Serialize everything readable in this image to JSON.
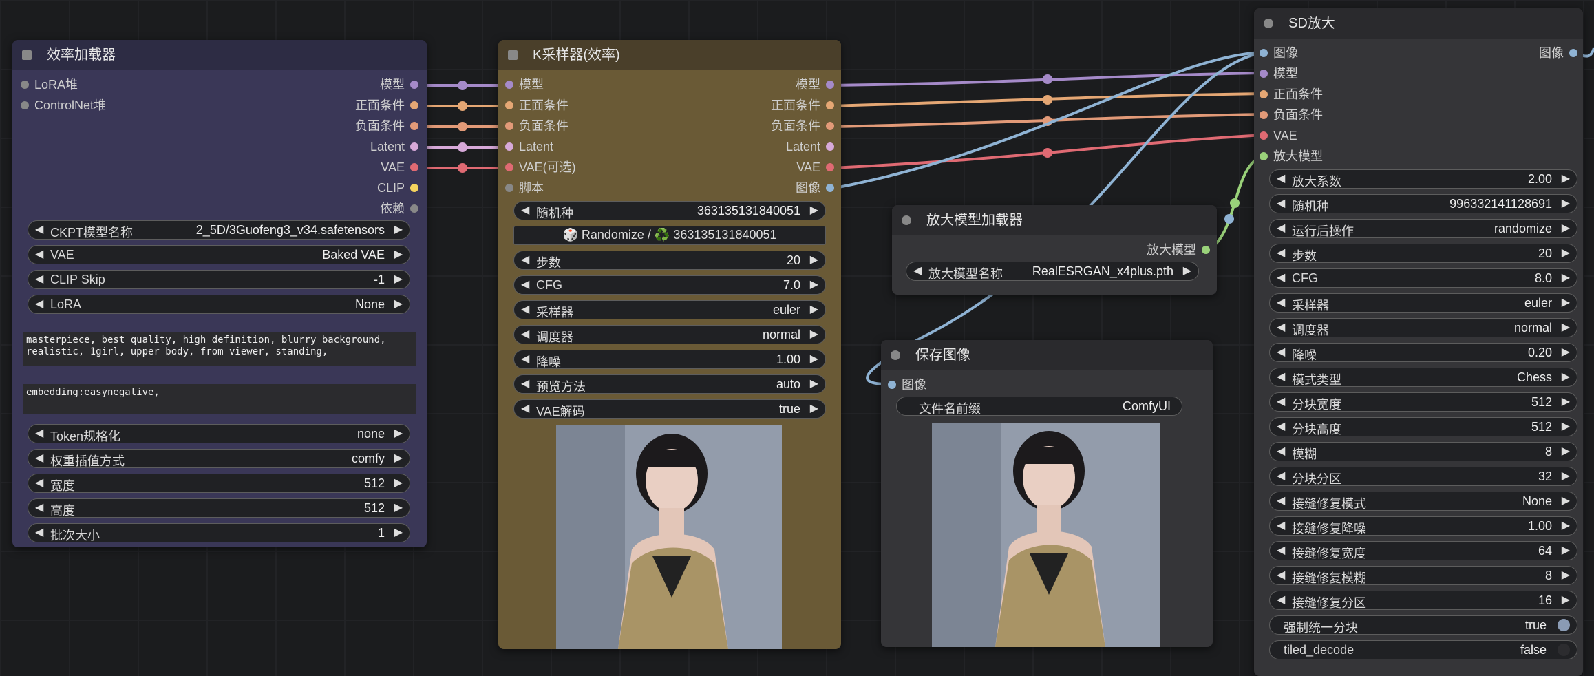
{
  "efficiency_loader": {
    "title": "效率加载器",
    "inputs": [
      "LoRA堆",
      "ControlNet堆"
    ],
    "outputs": [
      "模型",
      "正面条件",
      "负面条件",
      "Latent",
      "VAE",
      "CLIP",
      "依赖"
    ],
    "ckpt": {
      "label": "CKPT模型名称",
      "value": "2_5D/3Guofeng3_v34.safetensors"
    },
    "vae": {
      "label": "VAE",
      "value": "Baked VAE"
    },
    "clip_skip": {
      "label": "CLIP Skip",
      "value": "-1"
    },
    "lora": {
      "label": "LoRA",
      "value": "None"
    },
    "positive_prompt": "masterpiece, best quality, high definition, blurry background,\nrealistic, 1girl, upper body, from viewer, standing,",
    "negative_prompt": "embedding:easynegative,",
    "token_norm": {
      "label": "Token规格化",
      "value": "none"
    },
    "weight_interp": {
      "label": "权重插值方式",
      "value": "comfy"
    },
    "width": {
      "label": "宽度",
      "value": "512"
    },
    "height": {
      "label": "高度",
      "value": "512"
    },
    "batch": {
      "label": "批次大小",
      "value": "1"
    }
  },
  "ksampler": {
    "title": "K采样器(效率)",
    "inputs": [
      "模型",
      "正面条件",
      "负面条件",
      "Latent",
      "VAE(可选)",
      "脚本"
    ],
    "outputs": [
      "模型",
      "正面条件",
      "负面条件",
      "Latent",
      "VAE",
      "图像"
    ],
    "seed": {
      "label": "随机种",
      "value": "363135131840051"
    },
    "randomize_text": "🎲 Randomize / ♻️ 363135131840051",
    "steps": {
      "label": "步数",
      "value": "20"
    },
    "cfg": {
      "label": "CFG",
      "value": "7.0"
    },
    "sampler": {
      "label": "采样器",
      "value": "euler"
    },
    "scheduler": {
      "label": "调度器",
      "value": "normal"
    },
    "denoise": {
      "label": "降噪",
      "value": "1.00"
    },
    "preview": {
      "label": "预览方法",
      "value": "auto"
    },
    "vae_decode": {
      "label": "VAE解码",
      "value": "true"
    }
  },
  "upscale_loader": {
    "title": "放大模型加载器",
    "output": "放大模型",
    "model": {
      "label": "放大模型名称",
      "value": "RealESRGAN_x4plus.pth"
    }
  },
  "save_image": {
    "title": "保存图像",
    "input": "图像",
    "prefix": {
      "label": "文件名前缀",
      "value": "ComfyUI"
    }
  },
  "sd_upscale": {
    "title": "SD放大",
    "inputs": [
      "图像",
      "模型",
      "正面条件",
      "负面条件",
      "VAE",
      "放大模型"
    ],
    "output": "图像",
    "widgets": [
      {
        "label": "放大系数",
        "value": "2.00"
      },
      {
        "label": "随机种",
        "value": "996332141128691"
      },
      {
        "label": "运行后操作",
        "value": "randomize"
      },
      {
        "label": "步数",
        "value": "20"
      },
      {
        "label": "CFG",
        "value": "8.0"
      },
      {
        "label": "采样器",
        "value": "euler"
      },
      {
        "label": "调度器",
        "value": "normal"
      },
      {
        "label": "降噪",
        "value": "0.20"
      },
      {
        "label": "模式类型",
        "value": "Chess"
      },
      {
        "label": "分块宽度",
        "value": "512"
      },
      {
        "label": "分块高度",
        "value": "512"
      },
      {
        "label": "模糊",
        "value": "8"
      },
      {
        "label": "分块分区",
        "value": "32"
      },
      {
        "label": "接缝修复模式",
        "value": "None"
      },
      {
        "label": "接缝修复降噪",
        "value": "1.00"
      },
      {
        "label": "接缝修复宽度",
        "value": "64"
      },
      {
        "label": "接缝修复模糊",
        "value": "8"
      },
      {
        "label": "接缝修复分区",
        "value": "16"
      }
    ],
    "toggles": [
      {
        "label": "强制统一分块",
        "value": "true"
      },
      {
        "label": "tiled_decode",
        "value": "false"
      }
    ]
  },
  "colors": {
    "model": "#a58ac9",
    "positive": "#e5a774",
    "negative": "#e29a78",
    "latent": "#d7a9d9",
    "vae": "#e06a73",
    "clip": "#f4d35e",
    "image": "#8fb3d4",
    "upscale_model": "#9ad27a",
    "script": "#888888"
  }
}
